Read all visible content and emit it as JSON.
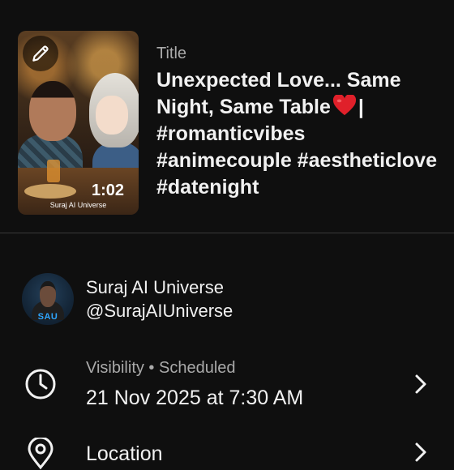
{
  "video": {
    "duration": "1:02",
    "thumbnail_watermark": "Suraj AI Universe"
  },
  "title": {
    "label": "Title",
    "text_part1": "Unexpected Love... Same Night, Same Table",
    "text_part2": "| #romanticvibes #animecouple #aestheticlove #datenight"
  },
  "channel": {
    "name": "Suraj AI Universe",
    "handle": "@SurajAIUniverse",
    "avatar_text": "SAU"
  },
  "visibility": {
    "label": "Visibility • Scheduled",
    "value": "21 Nov 2025 at 7:30 AM"
  },
  "location": {
    "label": "Location"
  },
  "icons": {
    "edit": "pencil-icon",
    "heart": "heart-emoji",
    "clock": "clock-icon",
    "location": "location-pin-icon",
    "chevron": "chevron-right-icon"
  },
  "colors": {
    "background": "#0f0f0f",
    "text": "#f1f1f1",
    "secondary_text": "#aaaaaa",
    "heart": "#e0202a",
    "avatar_accent": "#2ea6ff"
  }
}
